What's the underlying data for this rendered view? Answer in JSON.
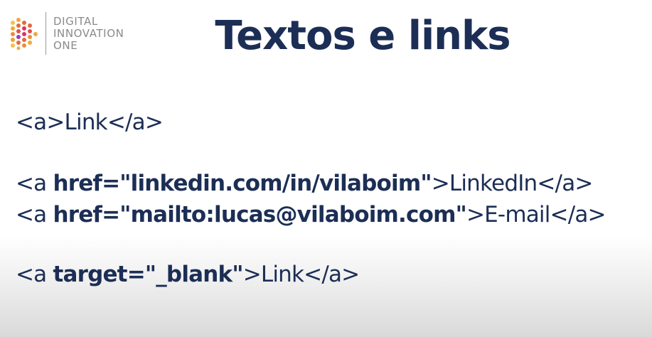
{
  "logo": {
    "line1": "DIGITAL",
    "line2": "INNOVATION",
    "line3": "ONE"
  },
  "title": "Textos e links",
  "lines": [
    {
      "prefix": "<a>Link</a>"
    },
    {
      "prefix": "<a ",
      "attr": "href=\"linkedin.com/in/vilaboim\"",
      "suffix": ">LinkedIn</a>"
    },
    {
      "prefix": "<a ",
      "attr": "href=\"mailto:lucas@vilaboim.com\"",
      "suffix": ">E-mail</a>"
    },
    {
      "prefix": "<a ",
      "attr": "target=\"_blank\"",
      "suffix": ">Link</a>"
    }
  ],
  "colors": {
    "text": "#1c2e55",
    "logo_text": "#8a8a8a",
    "logo_dots": [
      "#e9a23b",
      "#e6683c",
      "#d8356c",
      "#9b3fb4"
    ]
  }
}
